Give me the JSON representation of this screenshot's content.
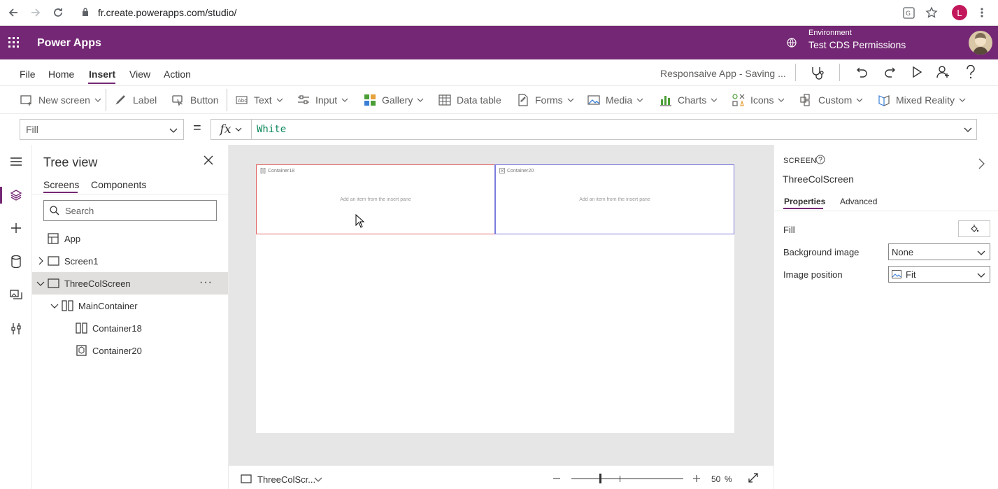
{
  "browser": {
    "url": "fr.create.powerapps.com/studio/",
    "avatar_letter": "L"
  },
  "header": {
    "app_name": "Power Apps",
    "environment_label": "Environment",
    "environment_name": "Test CDS Permissions"
  },
  "menu": {
    "items": [
      "File",
      "Home",
      "Insert",
      "View",
      "Action"
    ],
    "active": "Insert",
    "status": "Responsaive App - Saving ..."
  },
  "ribbon": {
    "items": [
      "New screen",
      "Label",
      "Button",
      "Text",
      "Input",
      "Gallery",
      "Data table",
      "Forms",
      "Media",
      "Charts",
      "Icons",
      "Custom",
      "Mixed Reality"
    ]
  },
  "formula": {
    "property": "Fill",
    "equals": "=",
    "fx": "fx",
    "value": "White"
  },
  "tree": {
    "title": "Tree view",
    "tabs": [
      "Screens",
      "Components"
    ],
    "search_placeholder": "Search",
    "nodes": [
      "App",
      "Screen1",
      "ThreeColScreen",
      "MainContainer",
      "Container18",
      "Container20"
    ],
    "more": "···"
  },
  "canvas": {
    "containers": [
      {
        "name": "Container18",
        "hint": "Add an item from the insert pane"
      },
      {
        "name": "Container20",
        "hint": "Add an item from the insert pane"
      }
    ]
  },
  "status_bar": {
    "screen_name": "ThreeColScr...",
    "zoom_percent": 50,
    "zoom_value": "50",
    "zoom_unit": "%"
  },
  "properties": {
    "type_label": "SCREEN",
    "screen_name": "ThreeColScreen",
    "tabs": [
      "Properties",
      "Advanced"
    ],
    "rows": [
      {
        "label": "Fill"
      },
      {
        "label": "Background image",
        "value": "None"
      },
      {
        "label": "Image position",
        "value": "Fit"
      }
    ]
  },
  "colors": {
    "brand": "#742774",
    "container18_border": "#e06666",
    "container20_border": "#7b7bdd",
    "formula_value": "#098658"
  }
}
